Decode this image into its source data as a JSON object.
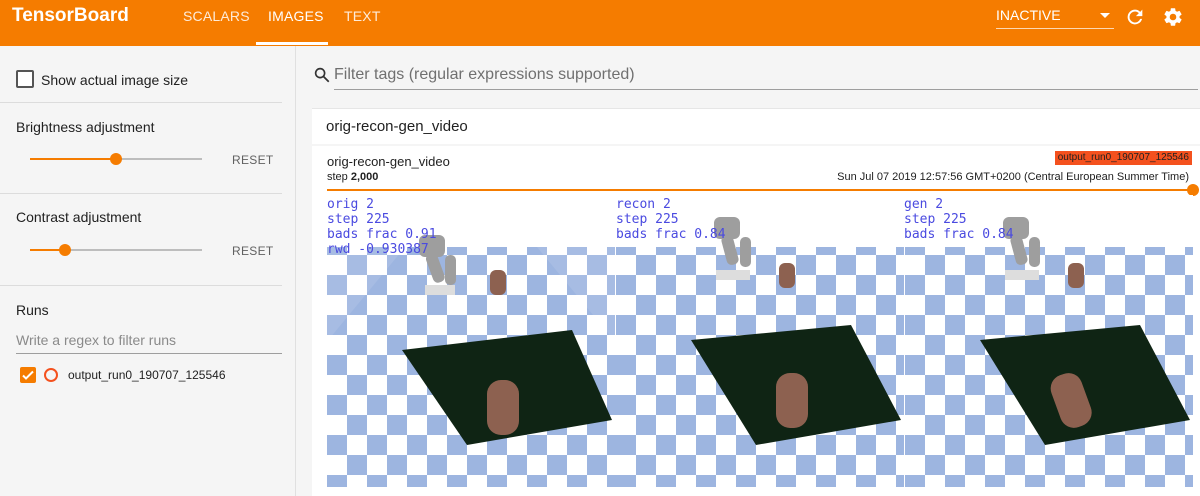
{
  "app": {
    "title": "TensorBoard"
  },
  "tabs": [
    {
      "label": "SCALARS",
      "active": false
    },
    {
      "label": "IMAGES",
      "active": true
    },
    {
      "label": "TEXT",
      "active": false
    }
  ],
  "header": {
    "status_select": "INACTIVE",
    "refresh_icon": "refresh-icon",
    "settings_icon": "gear-icon"
  },
  "sidebar": {
    "show_actual_size": {
      "label": "Show actual image size",
      "checked": false
    },
    "brightness": {
      "label": "Brightness adjustment",
      "reset": "RESET",
      "value": 0.5
    },
    "contrast": {
      "label": "Contrast adjustment",
      "reset": "RESET",
      "value": 0.2
    },
    "runs": {
      "title": "Runs",
      "filter_placeholder": "Write a regex to filter runs",
      "items": [
        {
          "name": "output_run0_190707_125546",
          "checked": true,
          "color": "#f4511e"
        }
      ]
    }
  },
  "main": {
    "filter_placeholder": "Filter tags (regular expressions supported)",
    "tag_group": "orig-recon-gen_video",
    "card": {
      "title": "orig-recon-gen_video",
      "step_label": "step",
      "step_value": "2,000",
      "run_badge": "output_run0_190707_125546",
      "timestamp": "Sun Jul 07 2019 12:57:56 GMT+0200 (Central European Summer Time)",
      "step_slider_value": 1.0,
      "panels": [
        {
          "lines": [
            "orig 2",
            "step 225",
            "bads frac 0.91",
            "rwd -0.930387"
          ]
        },
        {
          "lines": [
            "recon 2",
            "step 225",
            "bads frac 0.84"
          ]
        },
        {
          "lines": [
            "gen 2",
            "step 225",
            "bads frac 0.84"
          ]
        }
      ]
    }
  },
  "colors": {
    "accent": "#f57c00",
    "run": "#f4511e",
    "overlay_text": "#4a4ae0",
    "checker_blue": "#9db5e0",
    "mat": "#0f2414",
    "cylinder": "#8d6150"
  }
}
